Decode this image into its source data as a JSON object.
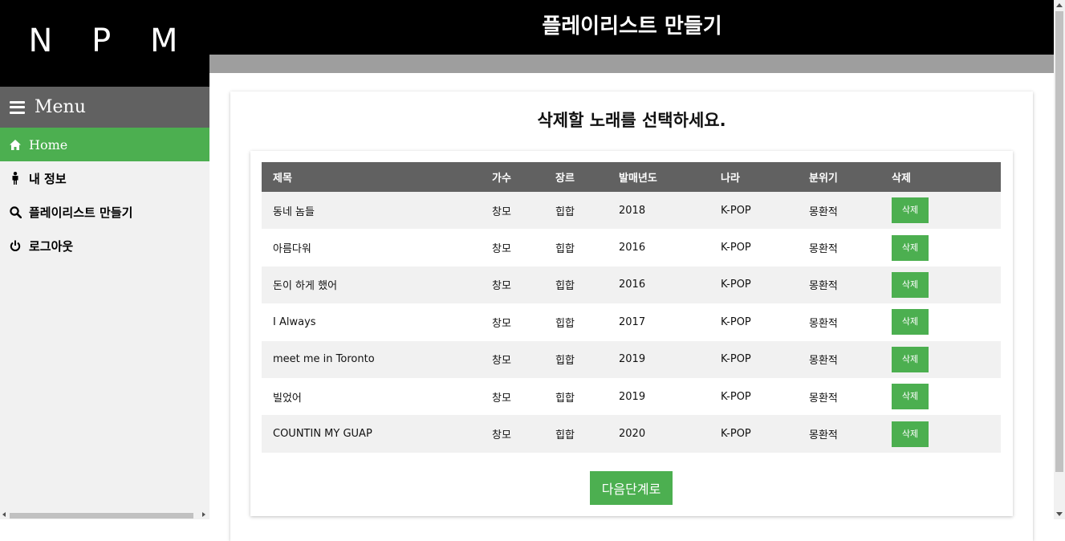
{
  "logo": "N P M",
  "header": {
    "title": "플레이리스트 만들기"
  },
  "sidebar": {
    "menu_title": "Menu",
    "items": [
      {
        "label": "Home",
        "icon": "home-icon",
        "active": true
      },
      {
        "label": "내 정보",
        "icon": "person-icon",
        "active": false
      },
      {
        "label": "플레이리스트 만들기",
        "icon": "search-icon",
        "active": false
      },
      {
        "label": "로그아웃",
        "icon": "power-icon",
        "active": false
      }
    ]
  },
  "main": {
    "title": "삭제할 노래를 선택하세요.",
    "table": {
      "headers": [
        "제목",
        "가수",
        "장르",
        "발매년도",
        "나라",
        "분위기",
        "삭제"
      ],
      "rows": [
        {
          "title": "동네 놈들",
          "artist": "창모",
          "genre": "힙합",
          "year": "2018",
          "country": "K-POP",
          "mood": "몽환적",
          "action": "삭제"
        },
        {
          "title": "아름다워",
          "artist": "창모",
          "genre": "힙합",
          "year": "2016",
          "country": "K-POP",
          "mood": "몽환적",
          "action": "삭제"
        },
        {
          "title": "돈이 하게 했어",
          "artist": "창모",
          "genre": "힙합",
          "year": "2016",
          "country": "K-POP",
          "mood": "몽환적",
          "action": "삭제"
        },
        {
          "title": "I Always",
          "artist": "창모",
          "genre": "힙합",
          "year": "2017",
          "country": "K-POP",
          "mood": "몽환적",
          "action": "삭제"
        },
        {
          "title": "meet me in Toronto",
          "artist": "창모",
          "genre": "힙합",
          "year": "2019",
          "country": "K-POP",
          "mood": "몽환적",
          "action": "삭제"
        },
        {
          "title": "빌었어",
          "artist": "창모",
          "genre": "힙합",
          "year": "2019",
          "country": "K-POP",
          "mood": "몽환적",
          "action": "삭제"
        },
        {
          "title": "COUNTIN MY GUAP",
          "artist": "창모",
          "genre": "힙합",
          "year": "2020",
          "country": "K-POP",
          "mood": "몽환적",
          "action": "삭제"
        }
      ]
    },
    "next_button": "다음단계로"
  },
  "colors": {
    "accent": "#4caf50",
    "header_bg": "#000000",
    "menu_bg": "#616161",
    "sidebar_bg": "#f1f1f1",
    "stripe": "#9e9e9e"
  }
}
